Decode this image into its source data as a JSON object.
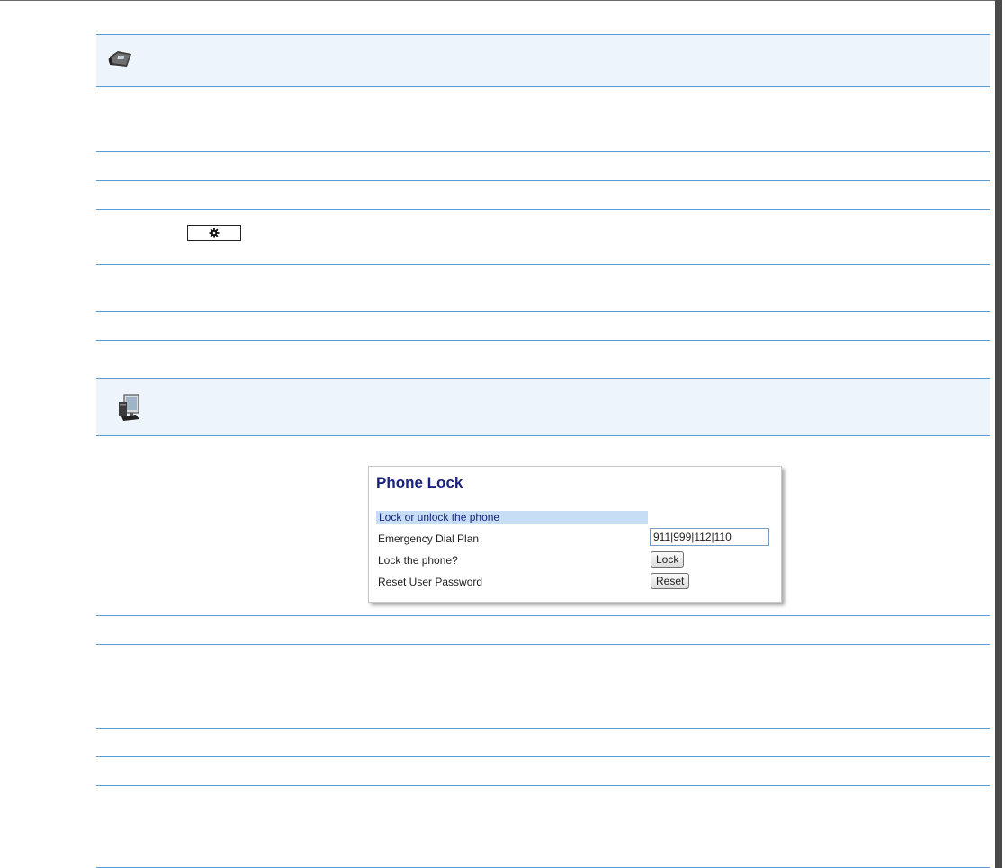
{
  "icons": {
    "phone_header": "desk-phone-icon",
    "web_header": "computer-monitor-icon",
    "options_key": "gear-icon"
  },
  "colors": {
    "rule": "#5b9bd5",
    "header_fill": "#eef4fb",
    "section_fill": "#c5def6",
    "title": "#1a237e"
  },
  "phone_lock": {
    "title": "Phone Lock",
    "section": "Lock or unlock the phone",
    "rows": [
      {
        "label": "Emergency Dial Plan",
        "value": "911|999|112|110"
      },
      {
        "label": "Lock the phone?",
        "button": "Lock"
      },
      {
        "label": "Reset User Password",
        "button": "Reset"
      }
    ]
  }
}
